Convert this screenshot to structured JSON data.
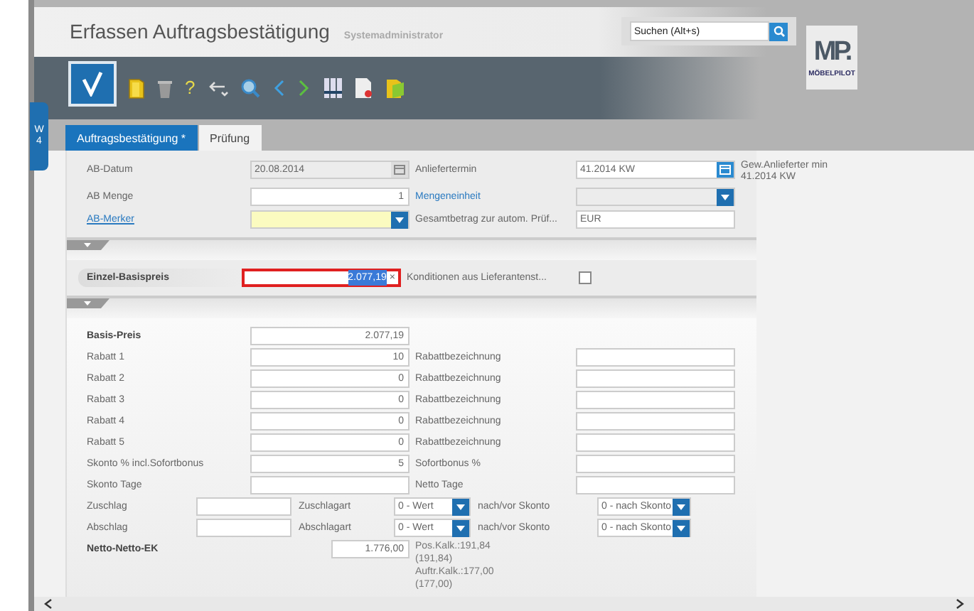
{
  "window": {
    "title": "Erfassen Auftragsbestätigung",
    "user": "Systemadministrator"
  },
  "search": {
    "placeholder": "Suchen (Alt+s)"
  },
  "toolbar": {
    "help": "?"
  },
  "logo": {
    "mark": "MP.",
    "name": "MÖBELPILOT"
  },
  "side_tab": {
    "label": "W4"
  },
  "tabs": [
    {
      "label": "Auftragsbestätigung *",
      "selected": true
    },
    {
      "label": "Prüfung",
      "selected": false
    }
  ],
  "header_rows": [
    {
      "label": "AB-Datum",
      "link": false,
      "field": {
        "kind": "date",
        "value": "20.08.2014",
        "disabled": true
      },
      "label2": "Anliefertermin",
      "label2_link": false,
      "field2": {
        "kind": "date",
        "value": "41.2014 KW",
        "disabled": false
      },
      "note": "Gew.Anlieferter min 41.2014 KW"
    },
    {
      "label": "AB Menge",
      "link": false,
      "field": {
        "kind": "number",
        "value": "1",
        "disabled": false
      },
      "label2": "Mengeneinheit",
      "label2_link": true,
      "field2": {
        "kind": "dropdown",
        "disabled": true
      }
    },
    {
      "label": "AB-Merker",
      "link": true,
      "field": {
        "kind": "dropdown",
        "disabled": false
      },
      "label2": "Gesamtbetrag zur autom. Prüf...",
      "label2_link": false,
      "field2": {
        "kind": "text",
        "value": "EUR",
        "disabled": false
      }
    }
  ],
  "price": {
    "label": "Einzel-Basispreis",
    "value": "2.077,19",
    "clear": "×",
    "option_label": "Konditionen aus Lieferantenst...",
    "checked": false
  },
  "basis": {
    "label": "Basis-Preis",
    "value": "2.077,19"
  },
  "rows": [
    {
      "label": "Rabatt 1",
      "value": "10",
      "label2": "Rabattbezeichnung"
    },
    {
      "label": "Rabatt 2",
      "value": "0",
      "label2": "Rabattbezeichnung"
    },
    {
      "label": "Rabatt 3",
      "value": "0",
      "label2": "Rabattbezeichnung"
    },
    {
      "label": "Rabatt 4",
      "value": "0",
      "label2": "Rabattbezeichnung"
    },
    {
      "label": "Rabatt 5",
      "value": "0",
      "label2": "Rabattbezeichnung"
    },
    {
      "label": "Skonto % incl.Sofortbonus",
      "value": "5",
      "label2": "Sofortbonus %"
    },
    {
      "label": "Skonto Tage",
      "label2": "Netto Tage"
    }
  ],
  "surcharges": [
    {
      "label": "Zuschlag",
      "type_label": "Zuschlagart",
      "type_value": "0 - Wert",
      "skonto_label": "nach/vor Skonto",
      "skonto_value": "0 - nach Skonto"
    },
    {
      "label": "Abschlag",
      "type_label": "Abschlagart",
      "type_value": "0 - Wert",
      "skonto_label": "nach/vor Skonto",
      "skonto_value": "0 - nach Skonto"
    }
  ],
  "net": {
    "label": "Netto-Netto-EK",
    "value": "1.776,00",
    "note": "Pos.Kalk.:191,84 (191,84) Auftr.Kalk.:177,00 (177,00)"
  }
}
